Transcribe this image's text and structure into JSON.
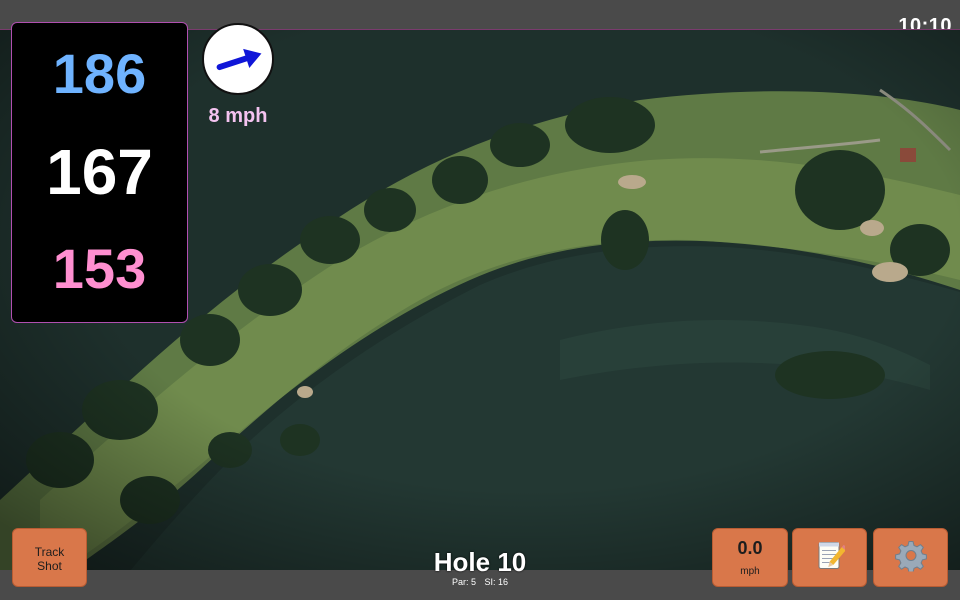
{
  "status": {
    "time": "10:10"
  },
  "distances": {
    "back": "186",
    "middle": "167",
    "front": "153"
  },
  "wind": {
    "speed": "8 mph",
    "direction_icon": "arrow-icon"
  },
  "hole": {
    "title": "Hole 10",
    "par_label": "Par: 5",
    "si_label": "SI: 16"
  },
  "buttons": {
    "track_shot_line1": "Track",
    "track_shot_line2": "Shot",
    "speed_value": "0.0",
    "speed_unit": "mph",
    "notes_icon": "notepad-icon",
    "settings_icon": "gear-icon"
  },
  "colors": {
    "back_distance": "#6fb3ff",
    "middle_distance": "#ffffff",
    "front_distance": "#ff8fd0",
    "button_accent": "#d9774a",
    "wind_label": "#f4c3f0"
  }
}
